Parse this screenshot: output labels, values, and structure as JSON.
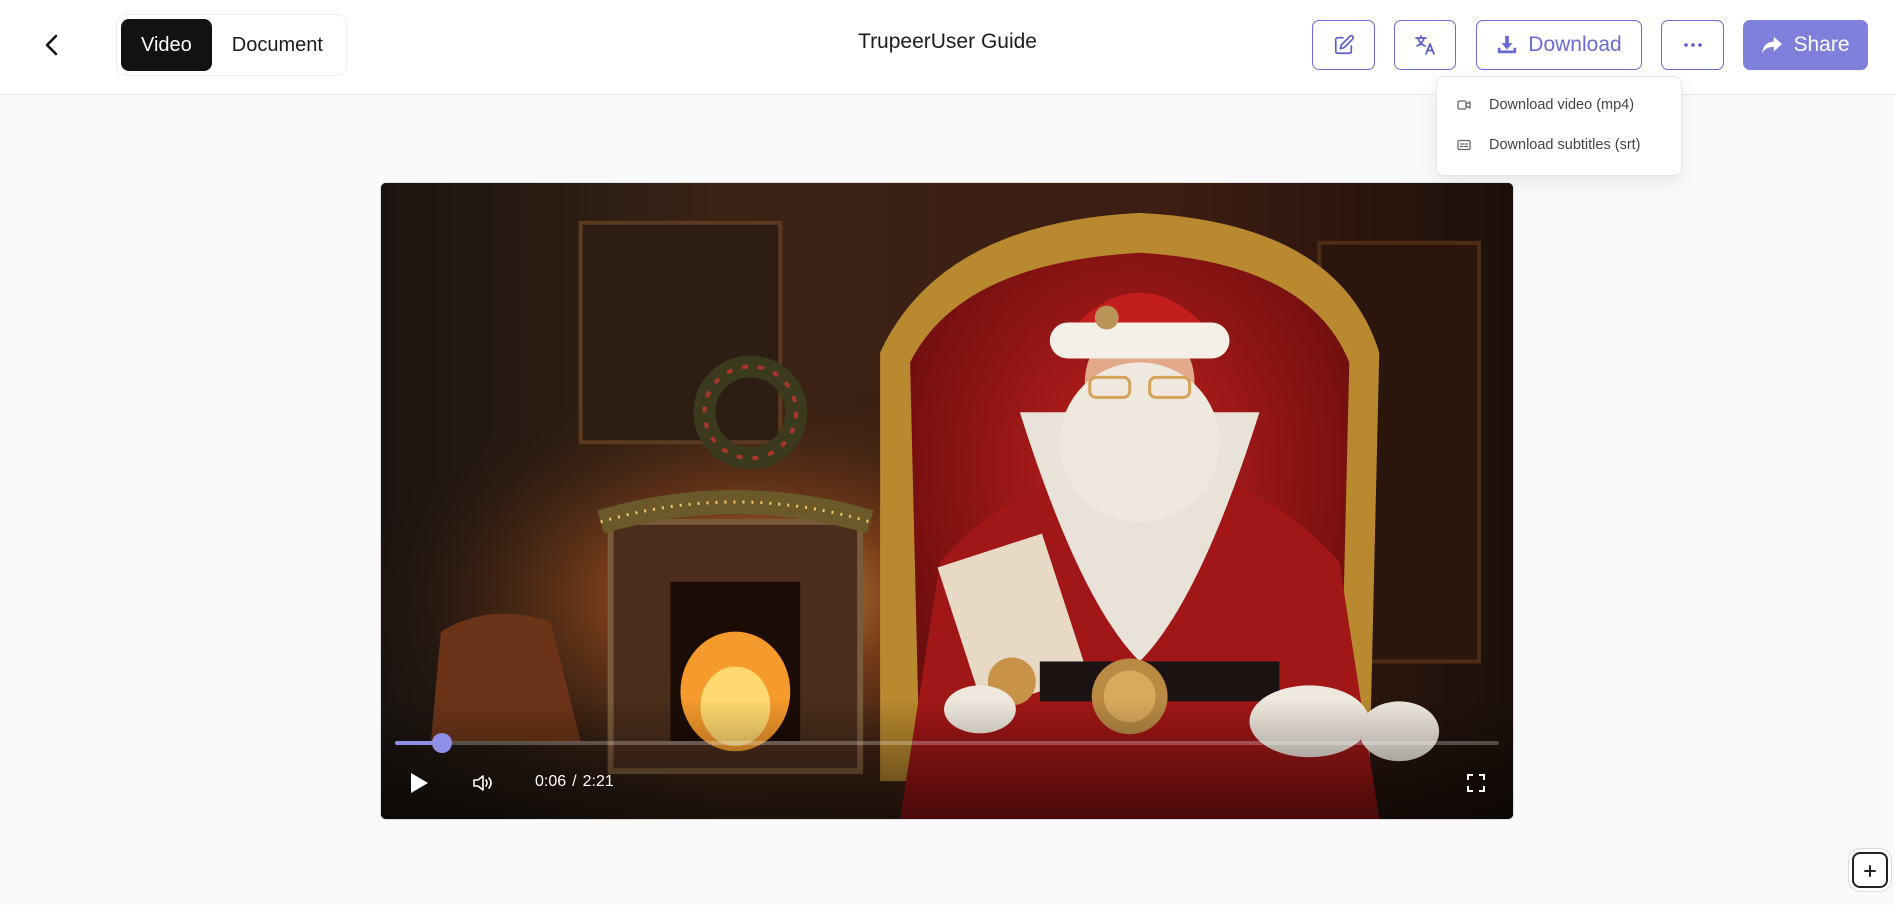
{
  "header": {
    "title": "TrupeerUser Guide",
    "tabs": [
      {
        "label": "Video",
        "active": true
      },
      {
        "label": "Document",
        "active": false
      }
    ],
    "download_label": "Download",
    "share_label": "Share"
  },
  "download_menu": {
    "items": [
      {
        "label": "Download video (mp4)",
        "icon": "video-camera-icon"
      },
      {
        "label": "Download subtitles (srt)",
        "icon": "subtitles-icon"
      }
    ]
  },
  "player": {
    "current_time": "0:06",
    "separator": "/",
    "duration": "2:21",
    "progress_fraction": 0.0426
  },
  "colors": {
    "accent": "#6a6ad3",
    "share_bg": "#7f7fdc",
    "progress": "#8f8fe8",
    "active_tab_bg": "#121212"
  }
}
